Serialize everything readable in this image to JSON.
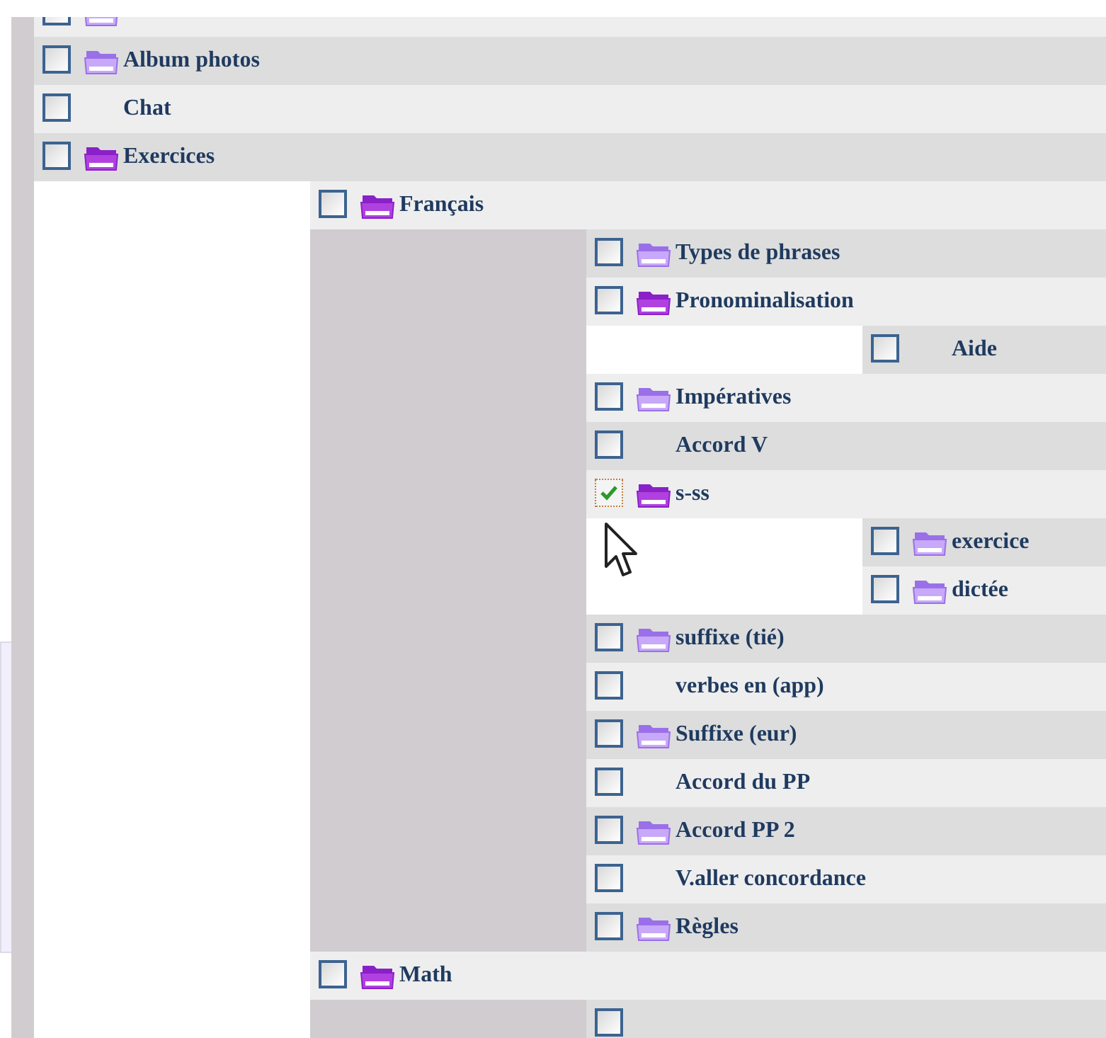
{
  "tree": [
    {
      "kind": "folder",
      "checked": false,
      "expanded": false
    },
    {
      "kind": "folder",
      "label": "Album photos",
      "checked": false,
      "expanded": false
    },
    {
      "kind": "item",
      "label": "Chat",
      "checked": false
    },
    {
      "kind": "folder",
      "label": "Exercices",
      "checked": false,
      "expanded": true,
      "children": [
        {
          "kind": "folder",
          "label": "Français",
          "checked": false,
          "expanded": true,
          "children": [
            {
              "kind": "folder",
              "label": "Types de phrases",
              "checked": false,
              "expanded": false
            },
            {
              "kind": "folder",
              "label": "Pronominalisation",
              "checked": false,
              "expanded": true,
              "children": [
                {
                  "kind": "item",
                  "label": "Aide",
                  "checked": false
                }
              ]
            },
            {
              "kind": "folder",
              "label": "Impératives",
              "checked": false,
              "expanded": false
            },
            {
              "kind": "item",
              "label": "Accord V",
              "checked": false
            },
            {
              "kind": "folder",
              "label": "s-ss",
              "checked": true,
              "expanded": true,
              "children": [
                {
                  "kind": "folder",
                  "label": "exercice",
                  "checked": false,
                  "expanded": false
                },
                {
                  "kind": "folder",
                  "label": "dictée",
                  "checked": false,
                  "expanded": false
                }
              ]
            },
            {
              "kind": "folder",
              "label": "suffixe (tié)",
              "checked": false,
              "expanded": false
            },
            {
              "kind": "item",
              "label": "verbes en (app)",
              "checked": false
            },
            {
              "kind": "folder",
              "label": "Suffixe (eur)",
              "checked": false,
              "expanded": false
            },
            {
              "kind": "item",
              "label": "Accord du PP",
              "checked": false
            },
            {
              "kind": "folder",
              "label": "Accord PP 2",
              "checked": false,
              "expanded": false
            },
            {
              "kind": "item",
              "label": "V.aller concordance",
              "checked": false
            },
            {
              "kind": "folder",
              "label": "Règles",
              "checked": false,
              "expanded": false
            }
          ]
        },
        {
          "kind": "folder",
          "label": "Math",
          "checked": false,
          "expanded": true,
          "children": [
            {
              "kind": "item",
              "checked": false
            }
          ]
        }
      ]
    }
  ]
}
